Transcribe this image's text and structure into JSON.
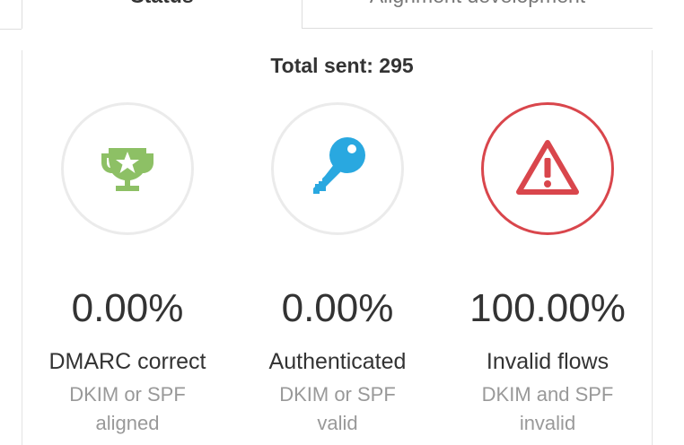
{
  "tabs": [
    {
      "label": "Status",
      "active": true
    },
    {
      "label": "Alignment development",
      "active": false
    }
  ],
  "summary": {
    "total_sent": "Total sent: 295"
  },
  "stats": [
    {
      "icon": "trophy-icon",
      "color": "#8dc065",
      "value": "0.00%",
      "label": "DMARC correct",
      "sub": "DKIM or SPF aligned"
    },
    {
      "icon": "key-icon",
      "color": "#29a8e0",
      "value": "0.00%",
      "label": "Authenticated",
      "sub": "DKIM or SPF valid"
    },
    {
      "icon": "warning-icon",
      "color": "#d9464c",
      "value": "100.00%",
      "label": "Invalid flows",
      "sub": "DKIM and SPF invalid"
    }
  ]
}
